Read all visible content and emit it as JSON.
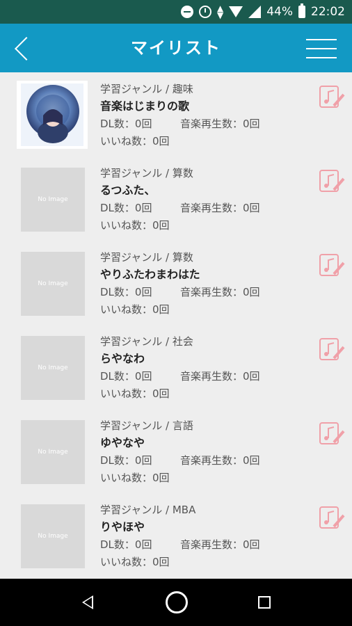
{
  "status_bar": {
    "battery": "44%",
    "time": "22:02"
  },
  "header": {
    "title": "マイリスト",
    "back_icon": "chevron-left-icon",
    "menu_icon": "hamburger-menu-icon"
  },
  "items": [
    {
      "genre": "学習ジャンル / 趣味",
      "name": "音楽はじまりの歌",
      "dl": "DL数：0回",
      "plays": "音楽再生数：0回",
      "likes": "いいね数：0回",
      "thumb_text": ""
    },
    {
      "genre": "学習ジャンル / 算数",
      "name": "るつふた、",
      "dl": "DL数：0回",
      "plays": "音楽再生数：0回",
      "likes": "いいね数：0回",
      "thumb_text": "No Image"
    },
    {
      "genre": "学習ジャンル / 算数",
      "name": "やりふたわまわはた",
      "dl": "DL数：0回",
      "plays": "音楽再生数：0回",
      "likes": "いいね数：0回",
      "thumb_text": "No Image"
    },
    {
      "genre": "学習ジャンル / 社会",
      "name": "らやなわ",
      "dl": "DL数：0回",
      "plays": "音楽再生数：0回",
      "likes": "いいね数：0回",
      "thumb_text": "No Image"
    },
    {
      "genre": "学習ジャンル / 言語",
      "name": "ゆやなや",
      "dl": "DL数：0回",
      "plays": "音楽再生数：0回",
      "likes": "いいね数：0回",
      "thumb_text": "No Image"
    },
    {
      "genre": "学習ジャンル / MBA",
      "name": "りやほや",
      "dl": "DL数：0回",
      "plays": "音楽再生数：0回",
      "likes": "いいね数：0回",
      "thumb_text": "No Image"
    }
  ],
  "colors": {
    "header": "#1299c4",
    "status_bar": "#1a5a4e",
    "edit_icon": "#f0a0a8"
  }
}
